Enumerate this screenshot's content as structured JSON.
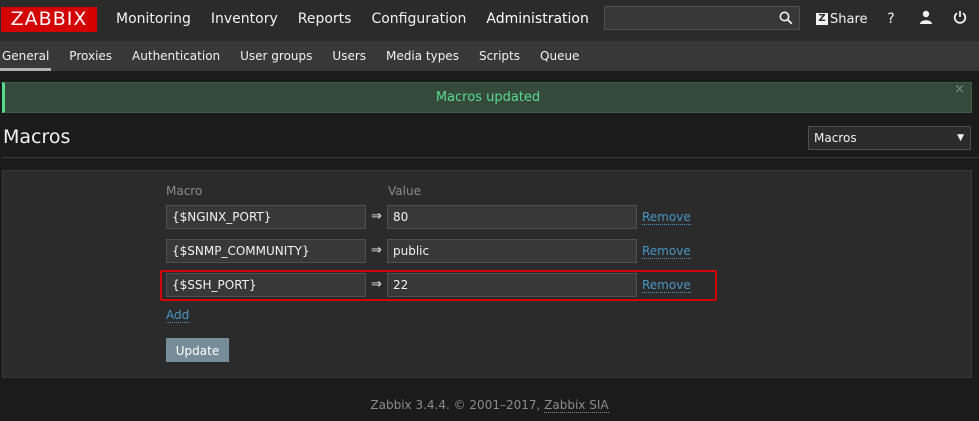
{
  "header": {
    "logo": "ZABBIX",
    "nav": [
      "Monitoring",
      "Inventory",
      "Reports",
      "Configuration",
      "Administration"
    ],
    "active_nav": "Administration",
    "share_label": "Share",
    "share_badge": "Z",
    "help_glyph": "?"
  },
  "subnav": {
    "items": [
      "General",
      "Proxies",
      "Authentication",
      "User groups",
      "Users",
      "Media types",
      "Scripts",
      "Queue"
    ],
    "active": "General"
  },
  "message": {
    "text": "Macros updated"
  },
  "page": {
    "title": "Macros",
    "selector_value": "Macros"
  },
  "form": {
    "macro_header": "Macro",
    "value_header": "Value",
    "rows": [
      {
        "macro": "{$NGINX_PORT}",
        "value": "80",
        "remove": "Remove"
      },
      {
        "macro": "{$SNMP_COMMUNITY}",
        "value": "public",
        "remove": "Remove"
      },
      {
        "macro": "{$SSH_PORT}",
        "value": "22",
        "remove": "Remove"
      }
    ],
    "arrow": "⇒",
    "add_label": "Add",
    "update_label": "Update"
  },
  "footer": {
    "text": "Zabbix 3.4.4. © 2001–2017,",
    "link": "Zabbix SIA"
  },
  "colors": {
    "brand": "#d40000",
    "success": "#59db8f",
    "link": "#4796c4",
    "highlight_border": "#d40000"
  }
}
